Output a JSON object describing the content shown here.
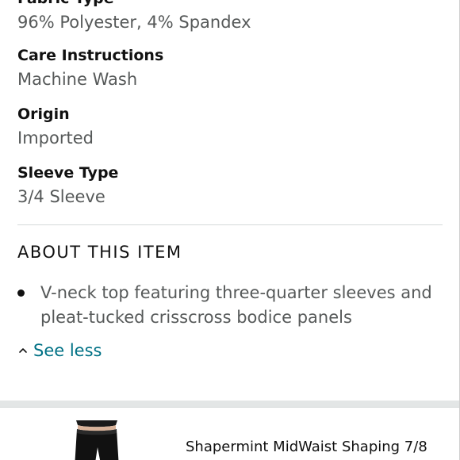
{
  "details": [
    {
      "label": "Fabric Type",
      "value": "96% Polyester, 4% Spandex"
    },
    {
      "label": "Care Instructions",
      "value": "Machine Wash"
    },
    {
      "label": "Origin",
      "value": "Imported"
    },
    {
      "label": "Sleeve Type",
      "value": "3/4 Sleeve"
    }
  ],
  "about": {
    "heading": "ABOUT THIS ITEM",
    "bullets": [
      "V-neck top featuring three-quarter sleeves and pleat-tucked crisscross bodice panels"
    ],
    "see_less_label": "See less"
  },
  "related_product": {
    "title": "Shapermint MidWaist Shaping 7/8",
    "thumbnail_icon": "leggings-product-image"
  },
  "colors": {
    "label": "#111111",
    "value": "#565959",
    "link": "#007185",
    "divider": "#d5d9d9",
    "band": "#e3e6e6"
  }
}
